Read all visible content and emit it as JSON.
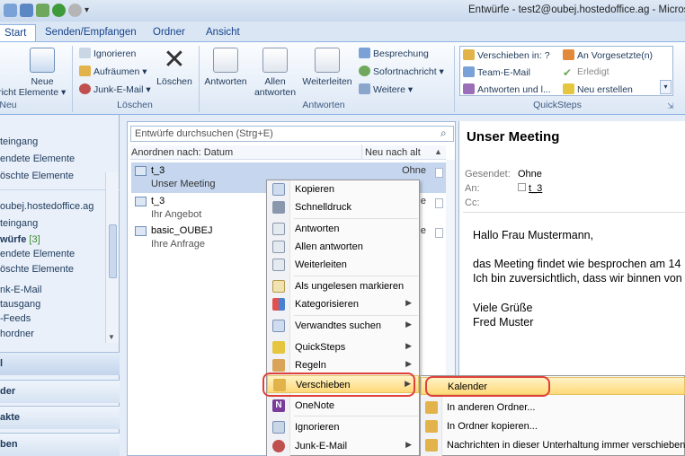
{
  "window": {
    "title": "Entwürfe - test2@oubej.hostedoffice.ag - Microso"
  },
  "tabs": [
    "Start",
    "Senden/Empfangen",
    "Ordner",
    "Ansicht"
  ],
  "ribbon": {
    "neu": {
      "new_items": "Neue\nElemente ▾",
      "new_mail_partial": "richt",
      "group": "Neu"
    },
    "loeschen": {
      "ignore": "Ignorieren",
      "cleanup": "Aufräumen ▾",
      "junk": "Junk-E-Mail ▾",
      "delete": "Löschen",
      "group": "Löschen"
    },
    "antworten": {
      "reply": "Antworten",
      "reply_all": "Allen\nantworten",
      "forward": "Weiterleiten",
      "meeting": "Besprechung",
      "im": "Sofortnachricht ▾",
      "more": "Weitere ▾",
      "group": "Antworten"
    },
    "quicksteps": {
      "items": [
        "Verschieben in: ?",
        "Team-E-Mail",
        "Antworten und l...",
        "An Vorgesetzte(n)",
        "Erledigt",
        "Neu erstellen"
      ],
      "group": "QuickSteps"
    }
  },
  "nav": {
    "items": [
      "teingang",
      "endete Elemente",
      "öschte Elemente",
      "oubej.hostedoffice.ag",
      "teingang",
      "würfe",
      "[3]",
      "endete Elemente",
      "öschte Elemente",
      "nk-E-Mail",
      "tausgang",
      "-Feeds",
      "hordner"
    ],
    "buttons": [
      "l",
      "der",
      "akte",
      "ben"
    ]
  },
  "list": {
    "search_placeholder": "Entwürfe durchsuchen (Strg+E)",
    "sort_label": "Anordnen nach: Datum",
    "sort_order": "Neu nach alt",
    "mails": [
      {
        "from": "t_3",
        "subject": "Unser Meeting",
        "flag": "Ohne"
      },
      {
        "from": "t_3",
        "subject": "Ihr Angebot",
        "flag": "e"
      },
      {
        "from": "basic_OUBEJ",
        "subject": "Ihre Anfrage",
        "flag": "e"
      }
    ]
  },
  "reader": {
    "subject": "Unser Meeting",
    "sent_label": "Gesendet:",
    "sent_value": "Ohne",
    "to_label": "An:",
    "to_value": "t_3",
    "cc_label": "Cc:",
    "body": [
      "Hallo Frau Mustermann,",
      "das Meeting findet wie besprochen am 14",
      "Ich bin zuversichtlich, dass wir binnen von",
      "Viele Grüße",
      "Fred Muster"
    ]
  },
  "context_menu": {
    "items": [
      "Kopieren",
      "Schnelldruck",
      "Antworten",
      "Allen antworten",
      "Weiterleiten",
      "Als ungelesen markieren",
      "Kategorisieren",
      "Verwandtes suchen",
      "QuickSteps",
      "Regeln",
      "Verschieben",
      "OneNote",
      "Ignorieren",
      "Junk-E-Mail"
    ]
  },
  "submenu": {
    "items": [
      "Kalender",
      "In anderen Ordner...",
      "In Ordner kopieren...",
      "Nachrichten in dieser Unterhaltung immer verschieben..."
    ]
  },
  "colors": {
    "highlight": "#ffd979",
    "ring": "#e0403a",
    "selected_row": "#c5d6ee"
  }
}
